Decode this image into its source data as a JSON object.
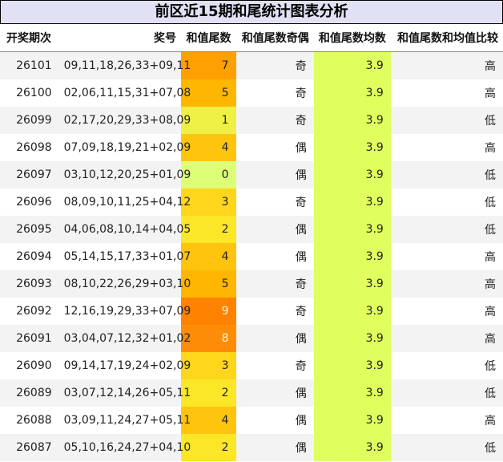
{
  "title": "前区近15期和尾统计图表分析",
  "headers": [
    "开奖期次",
    "奖号",
    "和值尾数",
    "和值尾数奇偶",
    "和值尾数均数",
    "和值尾数和均值比较"
  ],
  "tail_colors": {
    "0": "#ddff77",
    "1": "#eff046",
    "2": "#fbe728",
    "3": "#ffd61c",
    "4": "#ffc40e",
    "5": "#feb601",
    "7": "#ffa002",
    "8": "#ff8c07",
    "9": "#ff8200"
  },
  "avg_color": "#deff5e",
  "rows": [
    {
      "period": "26101",
      "numbers": "09,11,18,26,33+09,11",
      "tail": "7",
      "parity": "奇",
      "avg": "3.9",
      "compare": "高"
    },
    {
      "period": "26100",
      "numbers": "02,06,11,15,31+07,08",
      "tail": "5",
      "parity": "奇",
      "avg": "3.9",
      "compare": "高"
    },
    {
      "period": "26099",
      "numbers": "02,17,20,29,33+08,09",
      "tail": "1",
      "parity": "奇",
      "avg": "3.9",
      "compare": "低"
    },
    {
      "period": "26098",
      "numbers": "07,09,18,19,21+02,09",
      "tail": "4",
      "parity": "偶",
      "avg": "3.9",
      "compare": "高"
    },
    {
      "period": "26097",
      "numbers": "03,10,12,20,25+01,09",
      "tail": "0",
      "parity": "偶",
      "avg": "3.9",
      "compare": "低"
    },
    {
      "period": "26096",
      "numbers": "08,09,10,11,25+04,12",
      "tail": "3",
      "parity": "奇",
      "avg": "3.9",
      "compare": "低"
    },
    {
      "period": "26095",
      "numbers": "04,06,08,10,14+04,05",
      "tail": "2",
      "parity": "偶",
      "avg": "3.9",
      "compare": "低"
    },
    {
      "period": "26094",
      "numbers": "05,14,15,17,33+01,07",
      "tail": "4",
      "parity": "偶",
      "avg": "3.9",
      "compare": "高"
    },
    {
      "period": "26093",
      "numbers": "08,10,22,26,29+03,10",
      "tail": "5",
      "parity": "奇",
      "avg": "3.9",
      "compare": "高"
    },
    {
      "period": "26092",
      "numbers": "12,16,19,29,33+07,09",
      "tail": "9",
      "parity": "奇",
      "avg": "3.9",
      "compare": "高"
    },
    {
      "period": "26091",
      "numbers": "03,04,07,12,32+01,02",
      "tail": "8",
      "parity": "偶",
      "avg": "3.9",
      "compare": "高"
    },
    {
      "period": "26090",
      "numbers": "09,14,17,19,24+02,09",
      "tail": "3",
      "parity": "奇",
      "avg": "3.9",
      "compare": "低"
    },
    {
      "period": "26089",
      "numbers": "03,07,12,14,26+05,11",
      "tail": "2",
      "parity": "偶",
      "avg": "3.9",
      "compare": "低"
    },
    {
      "period": "26088",
      "numbers": "03,09,11,24,27+05,11",
      "tail": "4",
      "parity": "偶",
      "avg": "3.9",
      "compare": "高"
    },
    {
      "period": "26087",
      "numbers": "05,10,16,24,27+04,10",
      "tail": "2",
      "parity": "偶",
      "avg": "3.9",
      "compare": "低"
    }
  ]
}
